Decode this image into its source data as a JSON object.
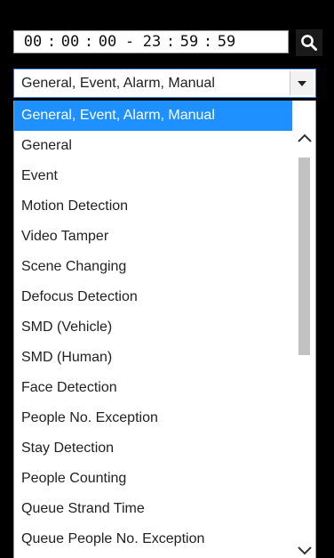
{
  "time_range": {
    "start_h": "00",
    "start_m": "00",
    "start_s": "00",
    "separator": ":",
    "dash": "-",
    "end_h": "23",
    "end_m": "59",
    "end_s": "59"
  },
  "search_icon": "search-icon",
  "select": {
    "value": "General, Event, Alarm, Manual",
    "arrow_icon": "triangle-down-icon"
  },
  "dropdown": {
    "options": [
      "General, Event, Alarm, Manual",
      "General",
      "Event",
      "Motion Detection",
      "Video Tamper",
      "Scene Changing",
      "Defocus Detection",
      "SMD (Vehicle)",
      "SMD (Human)",
      "Face Detection",
      "People No. Exception",
      "Stay Detection",
      "People Counting",
      "Queue Strand Time",
      "Queue People No. Exception"
    ],
    "selected_index": 0,
    "scroll_up_icon": "chevron-up-icon",
    "scroll_down_icon": "chevron-down-icon"
  },
  "colors": {
    "selected_bg": "#1e90ff",
    "select_border": "#3c7fd0",
    "background": "#000000"
  }
}
